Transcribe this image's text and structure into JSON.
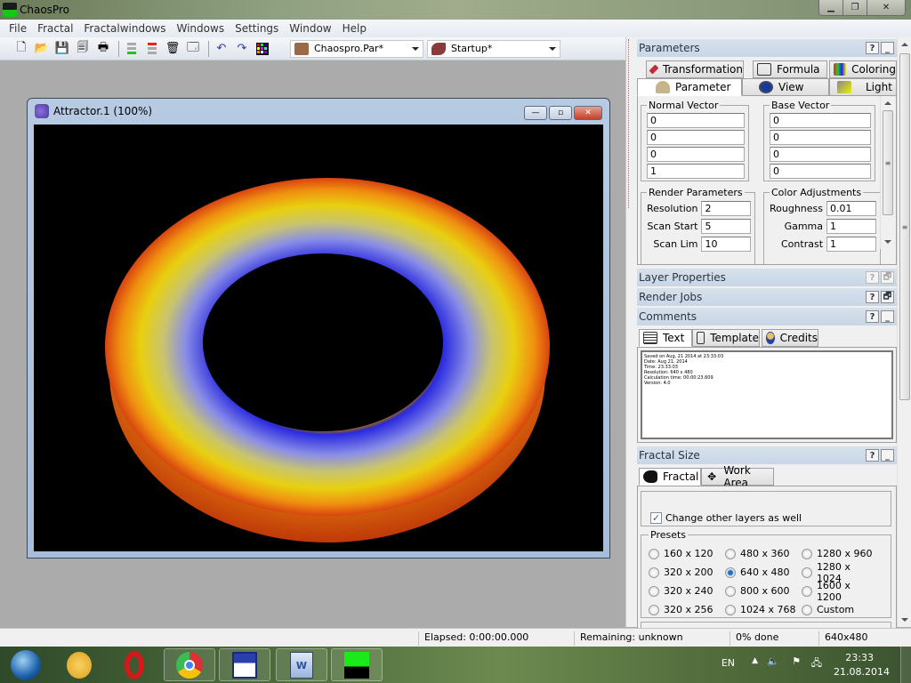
{
  "app": {
    "title": "ChaosPro"
  },
  "menu": [
    "File",
    "Fractal",
    "Fractalwindows",
    "Windows",
    "Settings",
    "Window",
    "Help"
  ],
  "toolbar": {
    "buttons": [
      "new-icon",
      "open-icon",
      "save-icon",
      "save-all-icon",
      "print-icon",
      "layer-up-icon",
      "layer-down-icon",
      "delete-icon",
      "window-icon",
      "undo-icon",
      "redo-icon",
      "palette-grid-icon"
    ],
    "parameter_file": "Chaospro.Par*",
    "formula_set": "Startup*"
  },
  "child_window": {
    "title": "Attractor.1 (100%)",
    "buttons": {
      "minimize": "—",
      "maximize": "▫",
      "close": "✕"
    }
  },
  "parameters_panel": {
    "title": "Parameters",
    "tabs_row1": [
      "Transformation",
      "Formula",
      "Coloring"
    ],
    "tabs_row2": [
      "Parameter",
      "View",
      "Light"
    ],
    "active_tab": "Parameter",
    "normal_vector": {
      "label": "Normal Vector",
      "values": [
        "0",
        "0",
        "0",
        "1"
      ]
    },
    "base_vector": {
      "label": "Base Vector",
      "values": [
        "0",
        "0",
        "0",
        "0"
      ]
    },
    "render_parameters": {
      "label": "Render Parameters",
      "fields": [
        {
          "label": "Resolution",
          "value": "2"
        },
        {
          "label": "Scan Start",
          "value": "5"
        },
        {
          "label": "Scan Lim",
          "value": "10"
        }
      ]
    },
    "color_adjustments": {
      "label": "Color Adjustments",
      "fields": [
        {
          "label": "Roughness",
          "value": "0.01"
        },
        {
          "label": "Gamma",
          "value": "1"
        },
        {
          "label": "Contrast",
          "value": "1"
        }
      ]
    }
  },
  "collapsed_panels": [
    "Layer Properties",
    "Render Jobs"
  ],
  "comments_panel": {
    "title": "Comments",
    "tabs": [
      "Text",
      "Template",
      "Credits"
    ],
    "active_tab": "Text",
    "lines": [
      "Saved on Aug, 21 2014 at 23:33:03",
      "Date: Aug 21, 2014",
      "Time: 23:33:03",
      "Resolution: 640 x 480",
      "Calculation time: 00:00:23.609",
      "Version: 4.0"
    ]
  },
  "fractal_size_panel": {
    "title": "Fractal Size",
    "tabs": [
      "Fractal",
      "Work Area"
    ],
    "active_tab": "Fractal",
    "change_other_layers": {
      "label": "Change other layers as well",
      "checked": true
    },
    "presets_label": "Presets",
    "presets": [
      "160 x 120",
      "480 x 360",
      "1280 x 960",
      "320 x 200",
      "640 x 480",
      "1280 x 1024",
      "320 x 240",
      "800 x 600",
      "1600 x 1200",
      "320 x 256",
      "1024 x 768",
      "Custom"
    ],
    "selected_preset": "640 x 480"
  },
  "statusbar": {
    "elapsed": "Elapsed: 0:00:00.000",
    "remaining": "Remaining: unknown",
    "progress": "0% done",
    "size": "640x480"
  },
  "taskbar": {
    "apps": [
      "start-orb",
      "paint",
      "opera",
      "chrome",
      "floppy-save",
      "word",
      "chaospro"
    ],
    "tray": {
      "language": "EN",
      "time": "23:33",
      "date": "21.08.2014"
    }
  }
}
